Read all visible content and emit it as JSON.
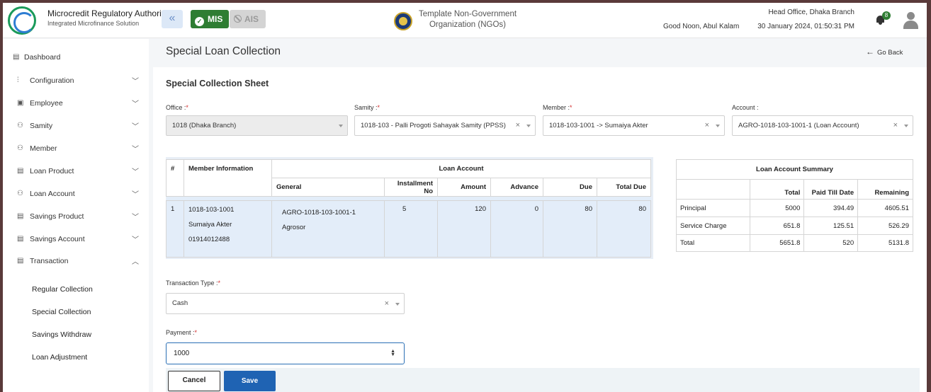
{
  "app": {
    "org_title": "Microcredit Regulatory Authority",
    "org_subtitle": "Integrated Microfinance Solution",
    "mis_label": "MIS",
    "ais_label": "AIS",
    "ngo_name_line1": "Template Non-Government",
    "ngo_name_line2": "Organization (NGOs)",
    "greeting": "Good Noon, Abul Kalam",
    "branch": "Head Office, Dhaka Branch",
    "datetime": "30 January 2024, 01:50:31 PM",
    "notification_count": "8",
    "accent_color": "#2e7d32",
    "primary_color": "#1f63b3"
  },
  "sidebar": {
    "items": [
      {
        "label": "Dashboard",
        "icon": "dashboard-icon"
      },
      {
        "label": "Configuration",
        "icon": "sliders-icon"
      },
      {
        "label": "Employee",
        "icon": "id-card-icon"
      },
      {
        "label": "Samity",
        "icon": "group-icon"
      },
      {
        "label": "Member",
        "icon": "users-icon"
      },
      {
        "label": "Loan Product",
        "icon": "document-icon"
      },
      {
        "label": "Loan Account",
        "icon": "users-icon"
      },
      {
        "label": "Savings Product",
        "icon": "document-icon"
      },
      {
        "label": "Savings Account",
        "icon": "document-icon"
      },
      {
        "label": "Transaction",
        "icon": "document-icon"
      }
    ],
    "transaction_sub": [
      "Regular Collection",
      "Special Collection",
      "Savings Withdraw",
      "Loan Adjustment"
    ]
  },
  "page": {
    "title": "Special Loan Collection",
    "go_back": "Go Back",
    "sheet_title": "Special Collection Sheet"
  },
  "filters": {
    "office_label": "Office :",
    "office_value": "1018 (Dhaka Branch)",
    "samity_label": "Samity :",
    "samity_value": "1018-103 - Palli Progoti Sahayak Samity (PPSS)",
    "member_label": "Member :",
    "member_value": "1018-103-1001 -> Sumaiya Akter",
    "account_label": "Account :",
    "account_value": "AGRO-1018-103-1001-1 (Loan Account)"
  },
  "loan_table": {
    "headers": {
      "num": "#",
      "member_info": "Member Information",
      "loan_account": "Loan Account",
      "general": "General",
      "installment_no": "Installment No",
      "amount": "Amount",
      "advance": "Advance",
      "due": "Due",
      "total_due": "Total Due"
    },
    "row": {
      "num": "1",
      "member_code": "1018-103-1001",
      "member_name": "Sumaiya Akter",
      "member_phone": "01914012488",
      "account_code": "AGRO-1018-103-1001-1",
      "account_product": "Agrosor",
      "installment_no": "5",
      "amount": "120",
      "advance": "0",
      "due": "80",
      "total_due": "80"
    }
  },
  "summary": {
    "title": "Loan Account Summary",
    "col_total": "Total",
    "col_paid": "Paid Till Date",
    "col_remaining": "Remaining",
    "rows": [
      {
        "label": "Principal",
        "total": "5000",
        "paid": "394.49",
        "remaining": "4605.51"
      },
      {
        "label": "Service Charge",
        "total": "651.8",
        "paid": "125.51",
        "remaining": "526.29"
      },
      {
        "label": "Total",
        "total": "5651.8",
        "paid": "520",
        "remaining": "5131.8"
      }
    ]
  },
  "form": {
    "transaction_type_label": "Transaction Type :",
    "transaction_type_value": "Cash",
    "payment_label": "Payment :",
    "payment_value": "1000",
    "required_mark": "*",
    "cancel_label": "Cancel",
    "save_label": "Save"
  }
}
